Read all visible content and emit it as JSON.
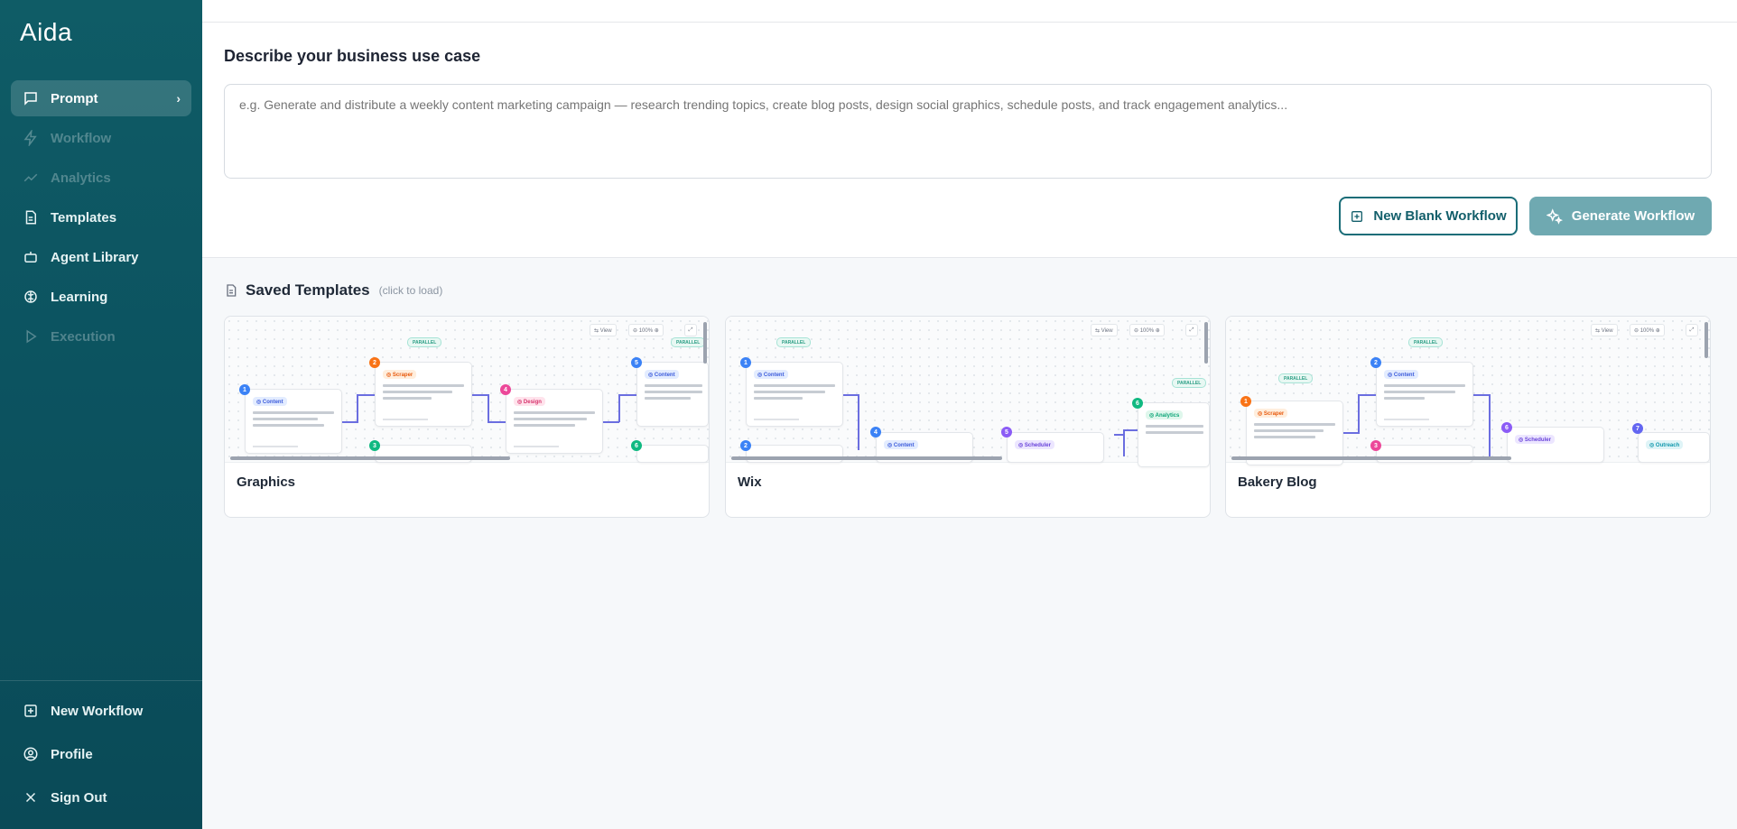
{
  "app": {
    "logo": "Aida"
  },
  "sidebar": {
    "items": [
      {
        "label": "Prompt",
        "icon": "message-square-icon",
        "state": "active"
      },
      {
        "label": "Workflow",
        "icon": "zap-icon",
        "state": "disabled"
      },
      {
        "label": "Analytics",
        "icon": "bar-chart-icon",
        "state": "disabled"
      },
      {
        "label": "Templates",
        "icon": "document-icon",
        "state": "normal"
      },
      {
        "label": "Agent Library",
        "icon": "robot-icon",
        "state": "normal"
      },
      {
        "label": "Learning",
        "icon": "brain-icon",
        "state": "normal"
      },
      {
        "label": "Execution",
        "icon": "play-icon",
        "state": "disabled"
      }
    ],
    "bottom": [
      {
        "label": "New Workflow",
        "icon": "plus-square-icon"
      },
      {
        "label": "Profile",
        "icon": "user-circle-icon"
      },
      {
        "label": "Sign Out",
        "icon": "close-icon"
      }
    ]
  },
  "main": {
    "use_case_title": "Describe your business use case",
    "prompt_placeholder": "e.g. Generate and distribute a weekly content marketing campaign — research trending topics, create blog posts, design social graphics, schedule posts, and track engagement analytics...",
    "new_blank_label": "New Blank Workflow",
    "generate_label": "Generate Workflow",
    "saved_title": "Saved Templates",
    "saved_hint": "(click to load)",
    "templates": [
      {
        "name": "Graphics"
      },
      {
        "name": "Wix"
      },
      {
        "name": "Bakery Blog"
      }
    ]
  },
  "colors": {
    "sidebar_bg": "#0c5360",
    "accent": "#1a6d78",
    "generate_bg": "#6fa9b1"
  }
}
